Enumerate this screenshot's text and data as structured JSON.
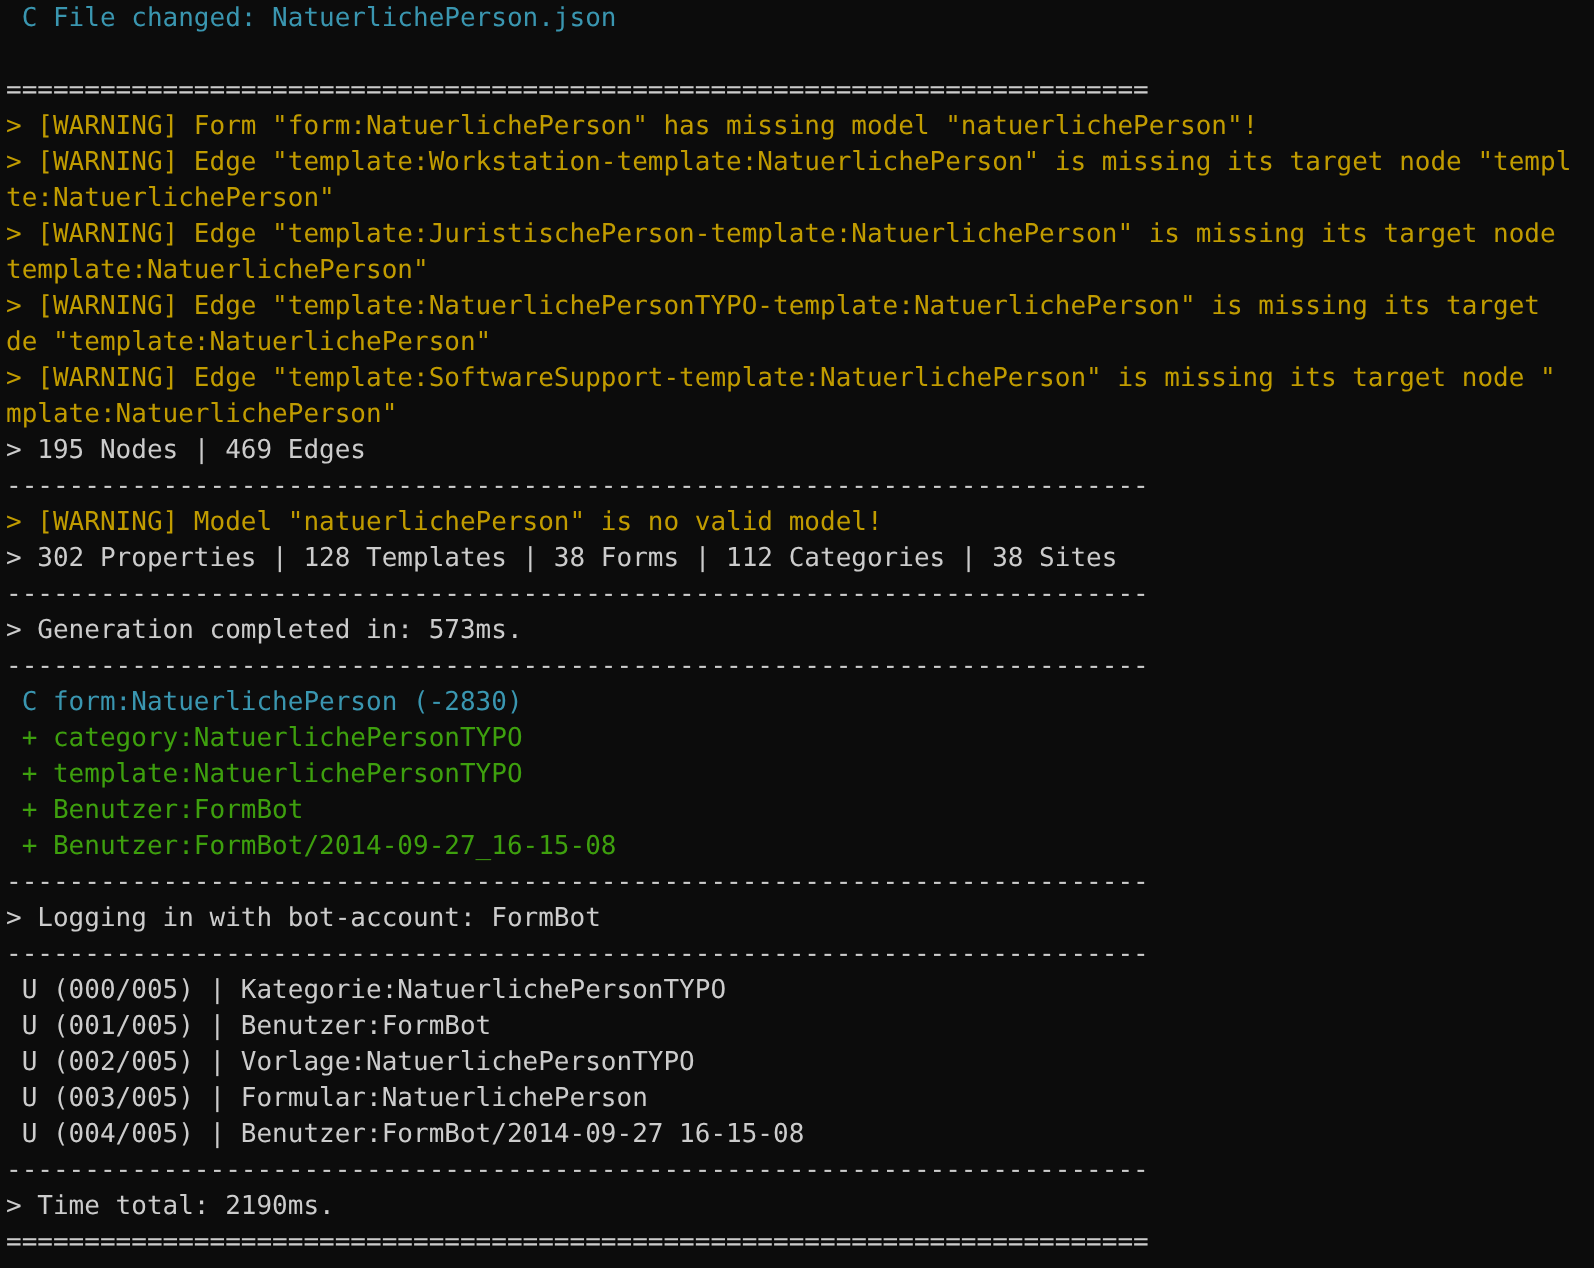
{
  "console": {
    "lines": [
      {
        "kind": "changed",
        "text": " C File changed: NatuerlichePerson.json"
      },
      {
        "kind": "blank"
      },
      {
        "kind": "plain",
        "text": "========================================================================="
      },
      {
        "kind": "warning",
        "text": "> [WARNING] Form \"form:NatuerlichePerson\" has missing model \"natuerlichePerson\"!"
      },
      {
        "kind": "warning",
        "text": "> [WARNING] Edge \"template:Workstation-template:NatuerlichePerson\" is missing its target node \"templ"
      },
      {
        "kind": "warning",
        "text": "te:NatuerlichePerson\""
      },
      {
        "kind": "warning",
        "text": "> [WARNING] Edge \"template:JuristischePerson-template:NatuerlichePerson\" is missing its target node"
      },
      {
        "kind": "warning",
        "text": "template:NatuerlichePerson\""
      },
      {
        "kind": "warning",
        "text": "> [WARNING] Edge \"template:NatuerlichePersonTYPO-template:NatuerlichePerson\" is missing its target"
      },
      {
        "kind": "warning",
        "text": "de \"template:NatuerlichePerson\""
      },
      {
        "kind": "warning",
        "text": "> [WARNING] Edge \"template:SoftwareSupport-template:NatuerlichePerson\" is missing its target node \""
      },
      {
        "kind": "warning",
        "text": "mplate:NatuerlichePerson\""
      },
      {
        "kind": "plain",
        "text": "> 195 Nodes | 469 Edges"
      },
      {
        "kind": "plain",
        "text": "-------------------------------------------------------------------------"
      },
      {
        "kind": "warning",
        "text": "> [WARNING] Model \"natuerlichePerson\" is no valid model!"
      },
      {
        "kind": "plain",
        "text": "> 302 Properties | 128 Templates | 38 Forms | 112 Categories | 38 Sites"
      },
      {
        "kind": "plain",
        "text": "-------------------------------------------------------------------------"
      },
      {
        "kind": "plain",
        "text": "> Generation completed in: 573ms."
      },
      {
        "kind": "plain",
        "text": "-------------------------------------------------------------------------"
      },
      {
        "kind": "changed",
        "text": " C form:NatuerlichePerson (-2830)"
      },
      {
        "kind": "added",
        "text": " + category:NatuerlichePersonTYPO"
      },
      {
        "kind": "added",
        "text": " + template:NatuerlichePersonTYPO"
      },
      {
        "kind": "added",
        "text": " + Benutzer:FormBot"
      },
      {
        "kind": "added",
        "text": " + Benutzer:FormBot/2014-09-27_16-15-08"
      },
      {
        "kind": "plain",
        "text": "-------------------------------------------------------------------------"
      },
      {
        "kind": "plain",
        "text": "> Logging in with bot-account: FormBot"
      },
      {
        "kind": "plain",
        "text": "-------------------------------------------------------------------------"
      },
      {
        "kind": "plain",
        "text": " U (000/005) | Kategorie:NatuerlichePersonTYPO"
      },
      {
        "kind": "plain",
        "text": " U (001/005) | Benutzer:FormBot"
      },
      {
        "kind": "plain",
        "text": " U (002/005) | Vorlage:NatuerlichePersonTYPO"
      },
      {
        "kind": "plain",
        "text": " U (003/005) | Formular:NatuerlichePerson"
      },
      {
        "kind": "plain",
        "text": " U (004/005) | Benutzer:FormBot/2014-09-27 16-15-08"
      },
      {
        "kind": "plain",
        "text": "-------------------------------------------------------------------------"
      },
      {
        "kind": "plain",
        "text": "> Time total: 2190ms."
      },
      {
        "kind": "plain",
        "text": "========================================================================="
      }
    ]
  }
}
